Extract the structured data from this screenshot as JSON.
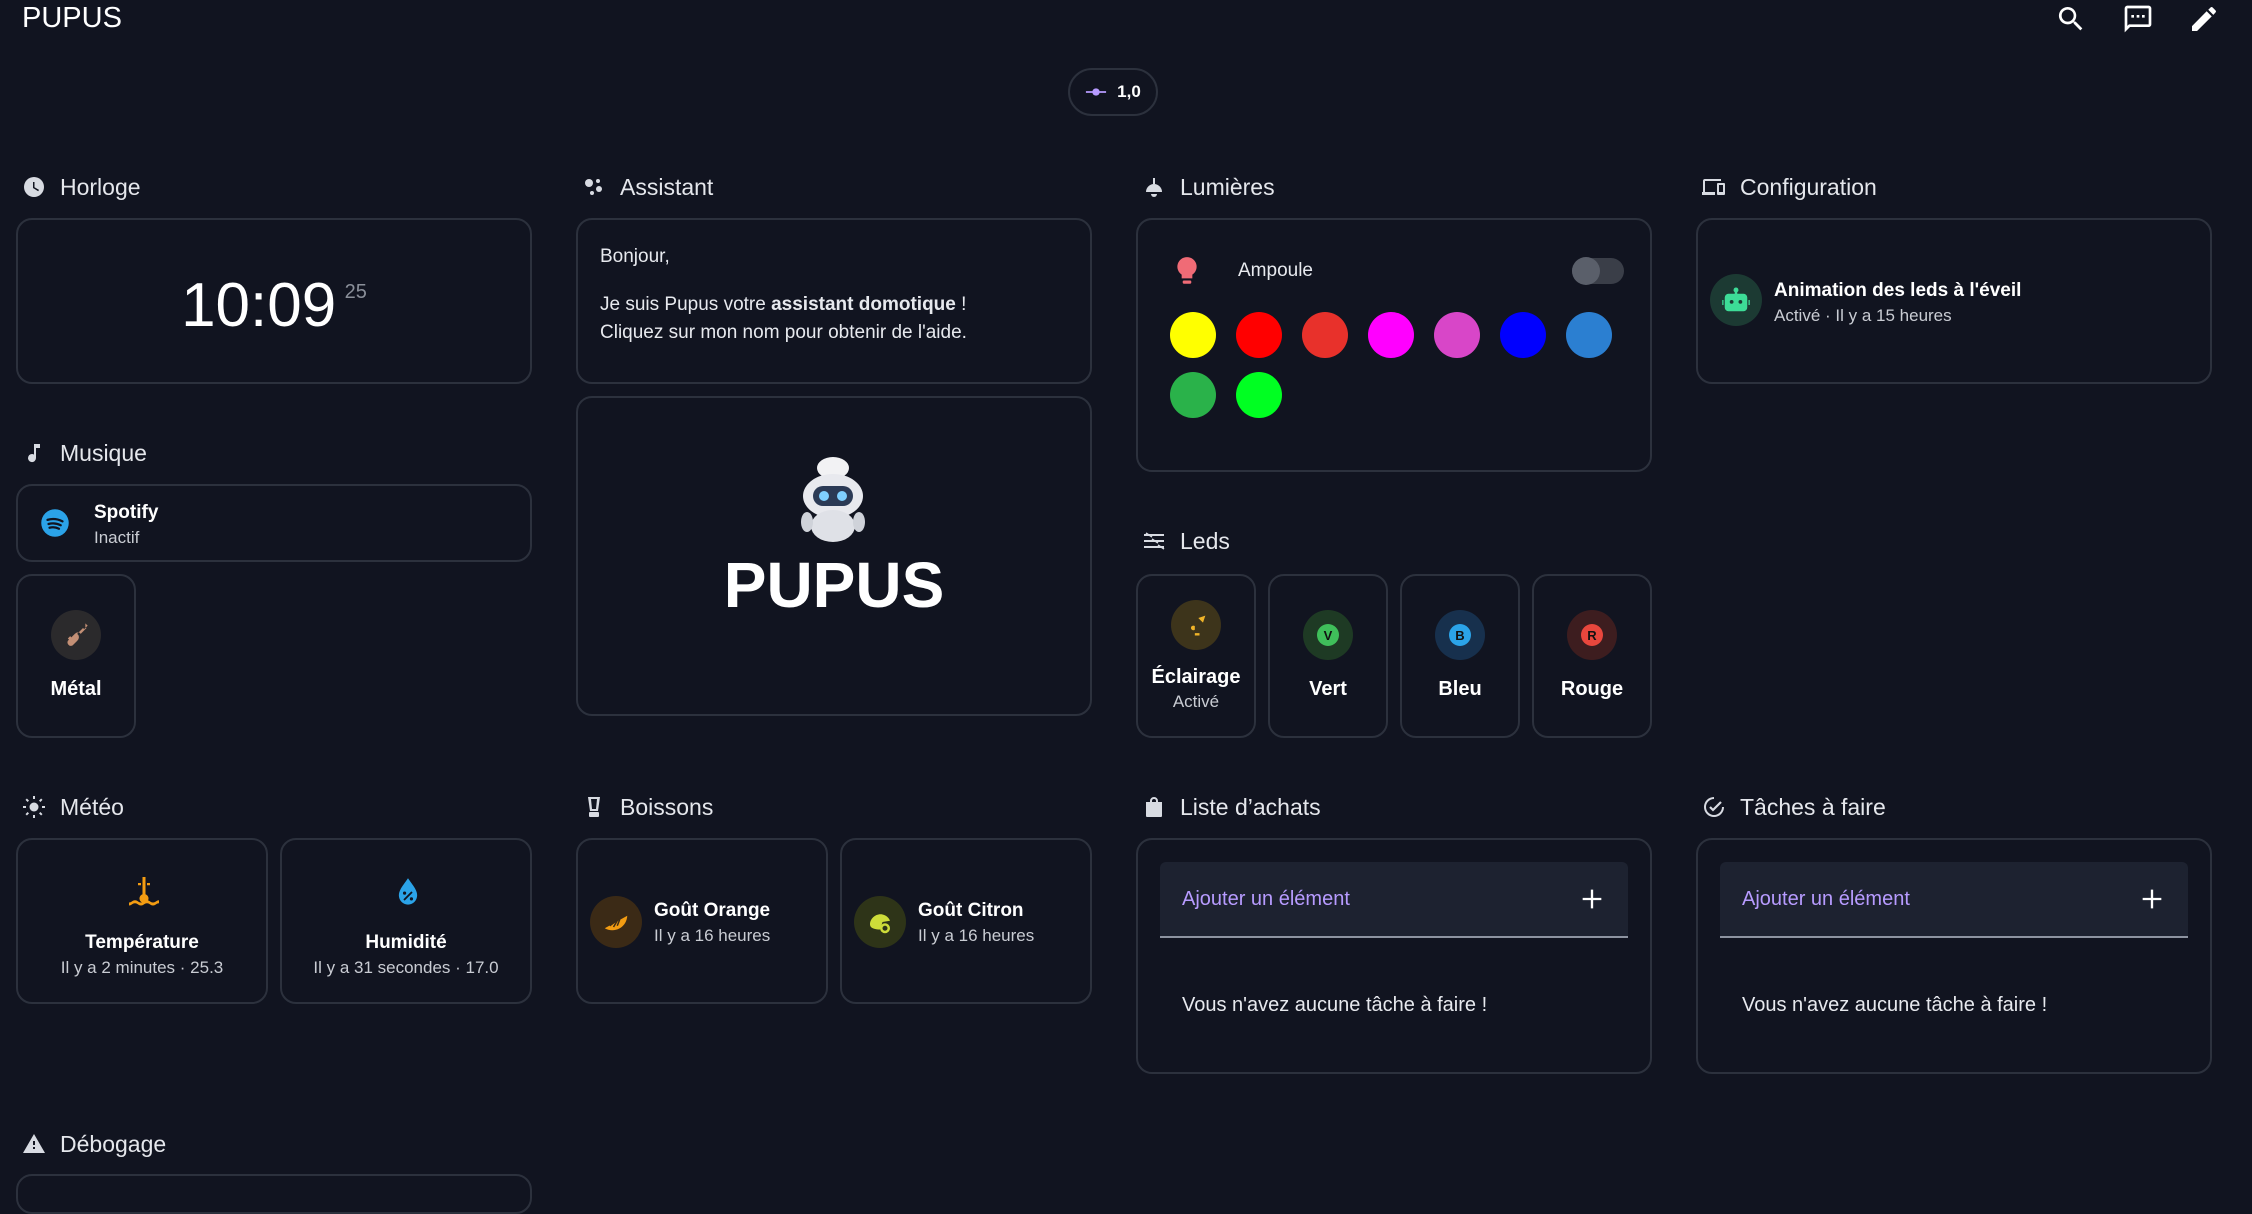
{
  "app": {
    "title": "PUPUS"
  },
  "chip": {
    "value": "1,0"
  },
  "sections": {
    "horloge": "Horloge",
    "assistant": "Assistant",
    "lumieres": "Lumières",
    "configuration": "Configuration",
    "musique": "Musique",
    "leds": "Leds",
    "meteo": "Météo",
    "boissons": "Boissons",
    "liste": "Liste d’achats",
    "taches": "Tâches à faire",
    "debogage": "Débogage"
  },
  "clock": {
    "time": "10:09",
    "seconds": "25"
  },
  "assistant": {
    "greeting": "Bonjour,",
    "line1_pre": "Je suis Pupus votre ",
    "line1_bold": "assistant domotique",
    "line1_post": " !",
    "line2": "Cliquez sur mon nom pour obtenir de l'aide.",
    "logo_text": "PUPUS"
  },
  "lights": {
    "name": "Ampoule",
    "toggle_on": false,
    "colors": [
      "#ffff00",
      "#ff0000",
      "#e8312b",
      "#ff00ff",
      "#d846c8",
      "#0000ff",
      "#2b7fd1",
      "#2ab24a",
      "#00ff22"
    ]
  },
  "config": {
    "title": "Animation des leds à l'éveil",
    "sub": "Activé · Il y a 15 heures"
  },
  "music": {
    "spotify": {
      "title": "Spotify",
      "sub": "Inactif"
    },
    "metal": {
      "title": "Métal"
    }
  },
  "leds": [
    {
      "title": "Éclairage",
      "sub": "Activé",
      "letter": ""
    },
    {
      "title": "Vert",
      "letter": "V"
    },
    {
      "title": "Bleu",
      "letter": "B"
    },
    {
      "title": "Rouge",
      "letter": "R"
    }
  ],
  "meteo": {
    "temp": {
      "title": "Température",
      "sub": "Il y a 2 minutes · 25.3"
    },
    "hum": {
      "title": "Humidité",
      "sub": "Il y a 31 secondes · 17.0"
    }
  },
  "boissons": {
    "orange": {
      "title": "Goût Orange",
      "sub": "Il y a 16 heures"
    },
    "citron": {
      "title": "Goût Citron",
      "sub": "Il y a 16 heures"
    }
  },
  "shopping": {
    "placeholder": "Ajouter un élément",
    "empty": "Vous n'avez aucune tâche à faire !"
  },
  "todo": {
    "placeholder": "Ajouter un élément",
    "empty": "Vous n'avez aucune tâche à faire !"
  },
  "colors": {
    "accent": "#b79bff",
    "background": "#111420",
    "border": "#2c313d"
  }
}
